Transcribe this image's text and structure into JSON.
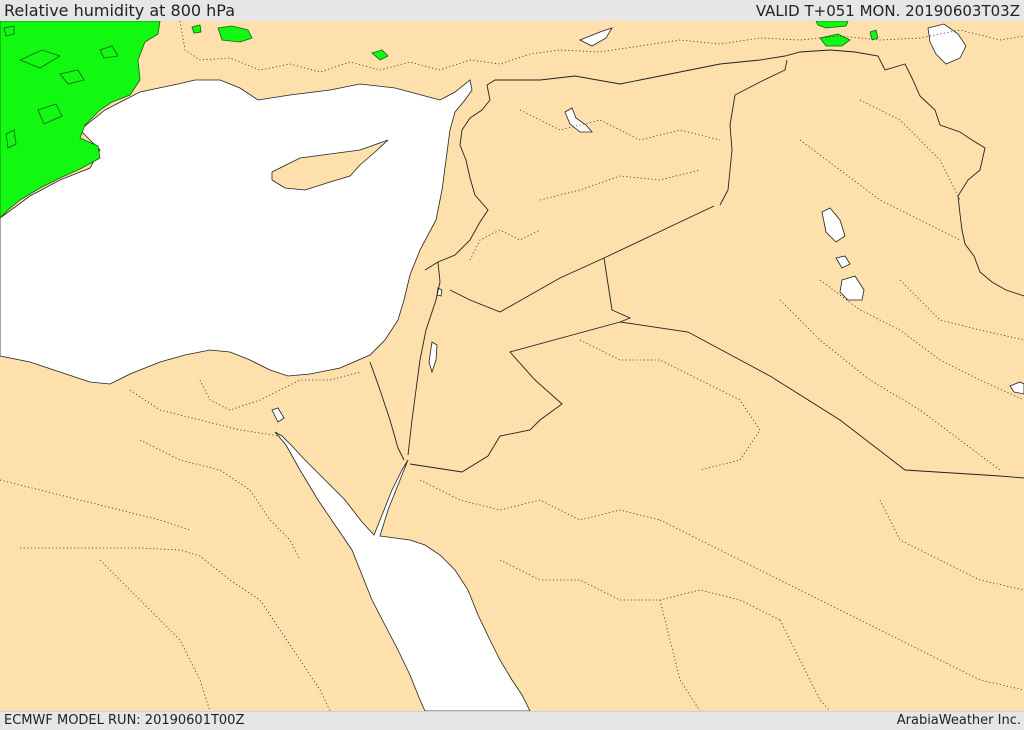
{
  "header": {
    "title": "Relative humidity at 800 hPa",
    "valid_time": "VALID T+051 MON. 20190603T03Z"
  },
  "footer": {
    "model_run": "ECMWF MODEL RUN: 20190601T00Z",
    "credit": "ArabiaWeather Inc."
  },
  "colors": {
    "land": "#fde0ab",
    "water": "#ffffff",
    "humidity_high": "#11f911",
    "border": "#222222"
  }
}
